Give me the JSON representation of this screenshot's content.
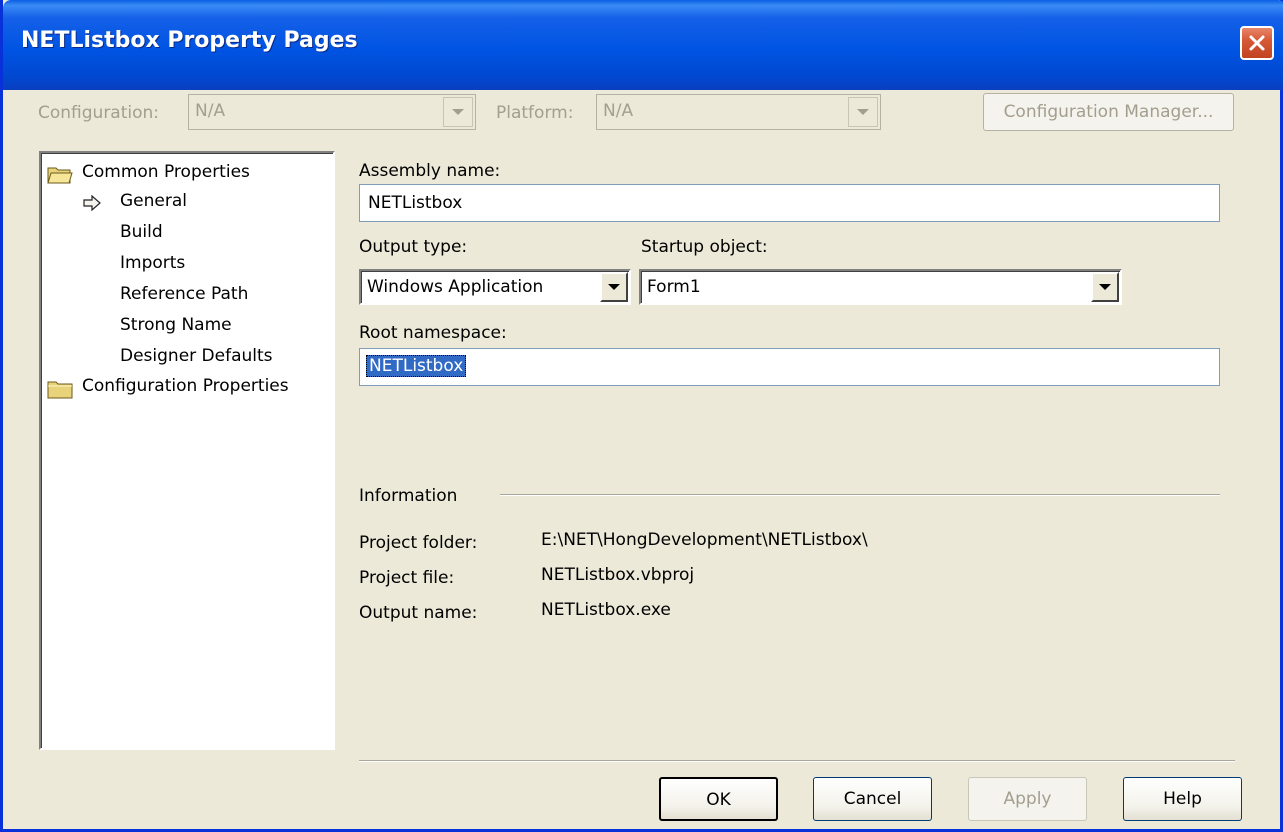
{
  "window": {
    "title": "NETListbox Property Pages"
  },
  "top_bar": {
    "configuration_label": "Configuration:",
    "configuration_value": "N/A",
    "platform_label": "Platform:",
    "platform_value": "N/A",
    "config_manager_label": "Configuration Manager..."
  },
  "tree": {
    "common_properties": "Common Properties",
    "items": [
      "General",
      "Build",
      "Imports",
      "Reference Path",
      "Strong Name",
      "Designer Defaults"
    ],
    "configuration_properties": "Configuration Properties"
  },
  "form": {
    "assembly_name_label": "Assembly name:",
    "assembly_name_value": "NETListbox",
    "output_type_label": "Output type:",
    "output_type_value": "Windows Application",
    "startup_object_label": "Startup object:",
    "startup_object_value": "Form1",
    "root_namespace_label": "Root namespace:",
    "root_namespace_value": "NETListbox"
  },
  "information": {
    "title": "Information",
    "project_folder_label": "Project folder:",
    "project_folder_value": "E:\\NET\\HongDevelopment\\NETListbox\\",
    "project_file_label": "Project file:",
    "project_file_value": "NETListbox.vbproj",
    "output_name_label": "Output name:",
    "output_name_value": "NETListbox.exe"
  },
  "buttons": {
    "ok": "OK",
    "cancel": "Cancel",
    "apply": "Apply",
    "help": "Help"
  }
}
